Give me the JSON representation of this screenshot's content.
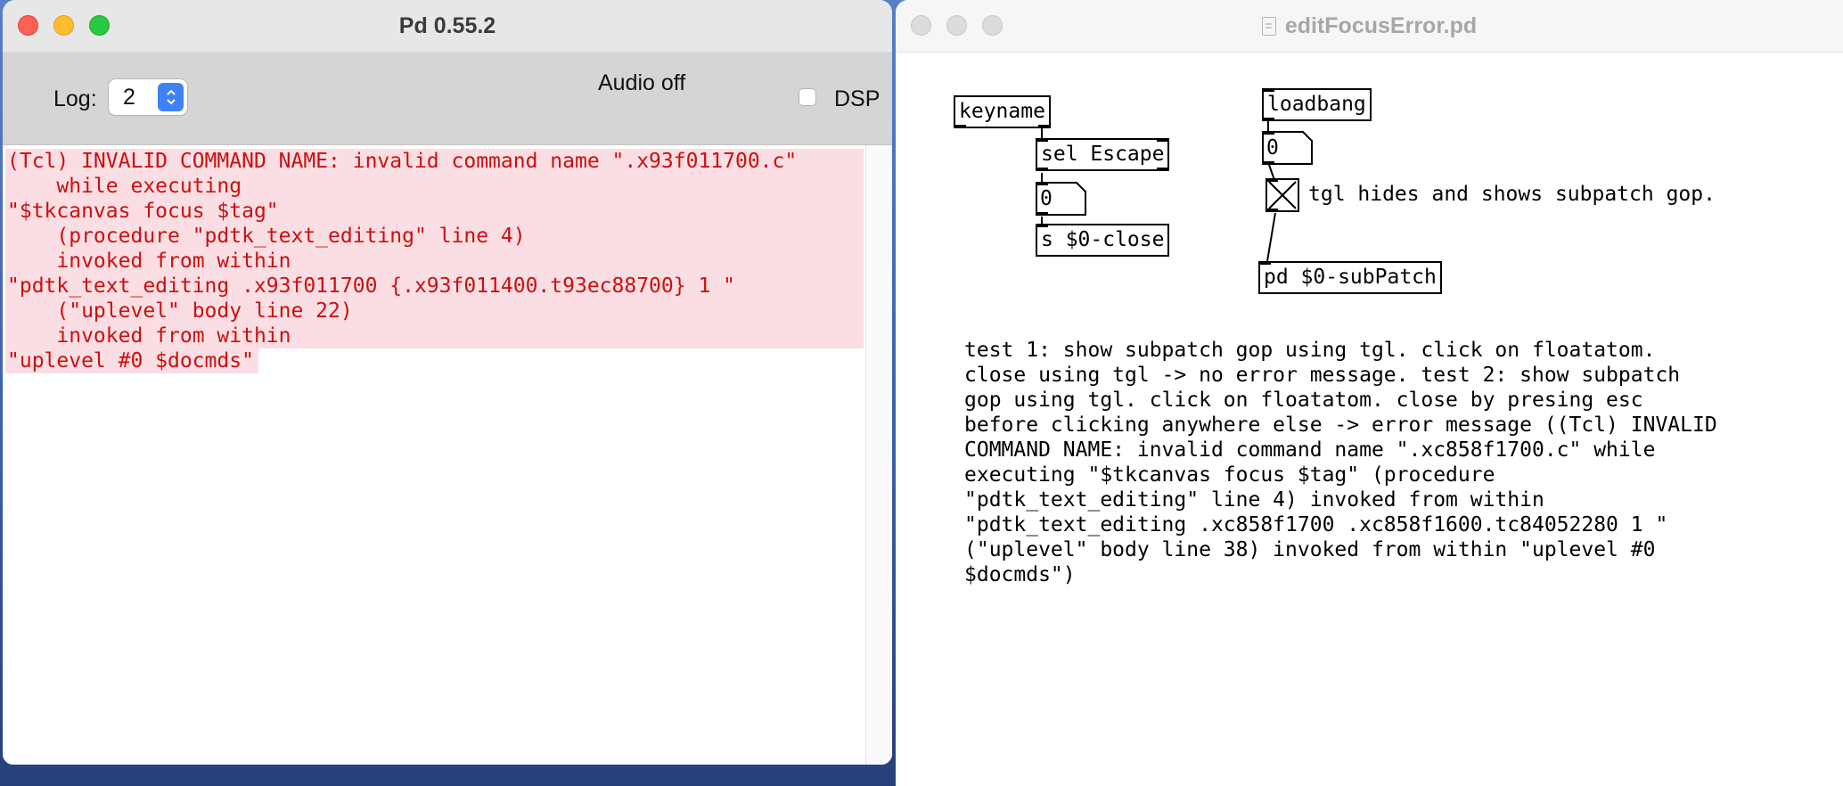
{
  "pd_window": {
    "title": "Pd 0.55.2",
    "log_label": "Log:",
    "log_level": "2",
    "audio_status": "Audio off",
    "dsp_label": "DSP",
    "log_lines": [
      "(Tcl) INVALID COMMAND NAME: invalid command name \".x93f011700.c\"",
      "    while executing",
      "\"$tkcanvas focus $tag\"",
      "    (procedure \"pdtk_text_editing\" line 4)",
      "    invoked from within",
      "\"pdtk_text_editing .x93f011700 {.x93f011400.t93ec88700} 1 \"",
      "    (\"uplevel\" body line 22)",
      "    invoked from within",
      "\"uplevel #0 $docmds\""
    ],
    "error_color": "#cc0f0f",
    "highlight_color": "#fadee3"
  },
  "patch_window": {
    "title": "editFocusError.pd",
    "objects": {
      "keyname": "keyname",
      "sel_escape": "sel Escape",
      "send_close": "s $0-close",
      "loadbang": "loadbang",
      "subpatch": "pd $0-subPatch"
    },
    "atoms": {
      "left_value": "0",
      "right_value": "0"
    },
    "toggle_comment": "tgl hides and shows subpatch gop.",
    "test_comment_lines": [
      "test 1: show subpatch gop using tgl. click on floatatom.",
      "close using tgl -> no error message. test 2: show subpatch",
      "gop using tgl. click on floatatom. close by presing esc",
      "before clicking anywhere else -> error message ((Tcl) INVALID",
      "COMMAND NAME: invalid command name \".xc858f1700.c\" while",
      "executing \"$tkcanvas focus $tag\" (procedure",
      "\"pdtk_text_editing\" line 4) invoked from within",
      "\"pdtk_text_editing .xc858f1700 .xc858f1600.tc84052280 1 \"",
      "(\"uplevel\" body line 38) invoked from within \"uplevel #0",
      "$docmds\")"
    ]
  }
}
